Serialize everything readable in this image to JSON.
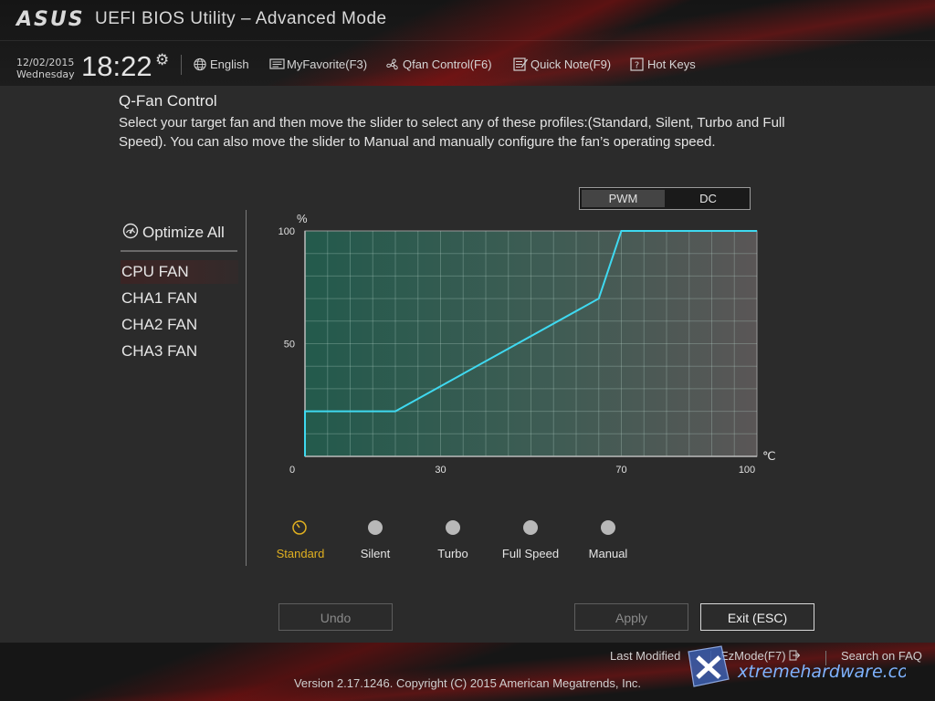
{
  "header": {
    "logo_text": "ASUS",
    "title": "UEFI BIOS Utility – Advanced Mode",
    "date": "12/02/2015",
    "weekday": "Wednesday",
    "time": "18:22",
    "toolbar": [
      {
        "label": "English",
        "icon": "globe-icon"
      },
      {
        "label": "MyFavorite(F3)",
        "icon": "myfavorite-icon"
      },
      {
        "label": "Qfan Control(F6)",
        "icon": "fan-icon"
      },
      {
        "label": "Quick Note(F9)",
        "icon": "note-icon"
      },
      {
        "label": "Hot Keys",
        "icon": "help-icon"
      }
    ]
  },
  "page": {
    "title": "Q-Fan Control",
    "description": "Select your target fan and then move the slider to select any of these profiles:(Standard, Silent, Turbo and Full Speed). You can also move the slider to Manual and manually configure the fan’s operating speed."
  },
  "mode_toggle": {
    "options": [
      "PWM",
      "DC"
    ],
    "selected": "PWM"
  },
  "sidebar": {
    "optimize_label": "Optimize All",
    "fans": [
      "CPU FAN",
      "CHA1 FAN",
      "CHA2 FAN",
      "CHA3 FAN"
    ],
    "selected": "CPU FAN"
  },
  "chart_data": {
    "type": "line",
    "xlabel": "℃",
    "ylabel": "%",
    "xlim": [
      0,
      100
    ],
    "ylim": [
      0,
      100
    ],
    "x_ticks": [
      "0",
      "30",
      "70",
      "100"
    ],
    "y_ticks": [
      "50",
      "100"
    ],
    "grid": true,
    "series": [
      {
        "x": [
          0,
          0,
          20,
          65,
          70,
          100
        ],
        "y": [
          0,
          20,
          20,
          70,
          100,
          100
        ]
      }
    ]
  },
  "profiles": {
    "options": [
      "Standard",
      "Silent",
      "Turbo",
      "Full Speed",
      "Manual"
    ],
    "selected": "Standard"
  },
  "buttons": {
    "undo": "Undo",
    "apply": "Apply",
    "exit": "Exit (ESC)"
  },
  "footer": {
    "last_modified": "Last Modified",
    "ezmode": "EzMode(F7)",
    "search": "Search on FAQ",
    "version": "Version 2.17.1246. Copyright (C) 2015 American Megatrends, Inc.",
    "watermark": "xtremehardware.com"
  },
  "colors": {
    "curve": "#3fd9f0",
    "profile_selected": "#e0b020",
    "dial": "#b8b8b8"
  }
}
